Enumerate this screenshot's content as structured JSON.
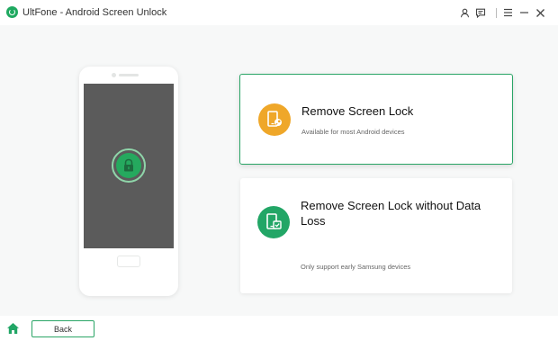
{
  "window": {
    "title": "UltFone - Android Screen Unlock",
    "controls": [
      "user-icon",
      "feedback-icon",
      "menu-icon",
      "minimize-icon",
      "close-icon"
    ]
  },
  "options": [
    {
      "title": "Remove Screen Lock",
      "description": "Available for most Android devices",
      "icon": "phone-key-icon",
      "selected": true,
      "color": "#efa729"
    },
    {
      "title": "Remove Screen Lock without Data Loss",
      "description": "Only support early Samsung devices",
      "icon": "phone-check-icon",
      "selected": false,
      "color": "#22a666"
    }
  ],
  "footer": {
    "back_label": "Back",
    "home_icon": "home-icon"
  },
  "colors": {
    "accent": "#2aa566",
    "brand": "#1fa960"
  }
}
